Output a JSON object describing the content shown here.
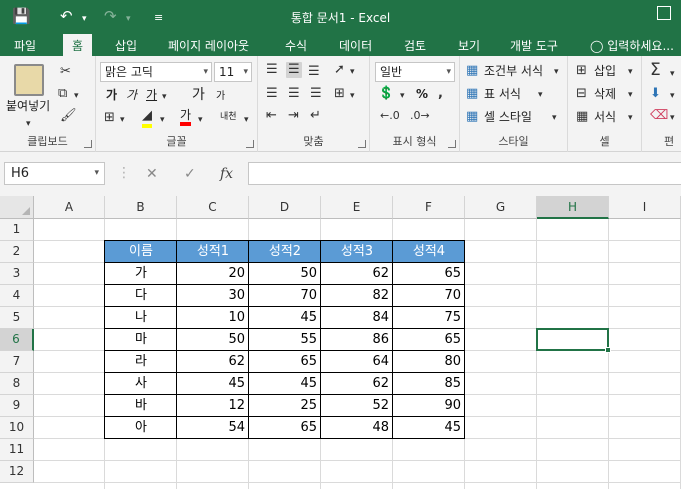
{
  "window": {
    "title": "통합 문서1 - Excel",
    "quick_access": {
      "save_icon": "save-icon",
      "undo_icon": "undo-icon",
      "redo_icon": "redo-icon",
      "customize_icon": "customize-qat-icon"
    }
  },
  "tabs": [
    "파일",
    "홈",
    "삽입",
    "페이지 레이아웃",
    "수식",
    "데이터",
    "검토",
    "보기",
    "개발 도구"
  ],
  "active_tab": "홈",
  "tell_me": "입력하세요...",
  "ribbon": {
    "clipboard": {
      "label": "클립보드",
      "paste": "붙여넣기"
    },
    "font": {
      "label": "글꼴",
      "font_name": "맑은 고딕",
      "font_size": "11",
      "bold": "가",
      "italic": "가",
      "underline": "가",
      "grow": "가",
      "shrink": "가",
      "font_color": "가",
      "phonetic": "내천"
    },
    "alignment": {
      "label": "맞춤"
    },
    "number": {
      "label": "표시 형식",
      "format": "일반",
      "percent": "%"
    },
    "styles": {
      "label": "스타일",
      "conditional": "조건부 서식",
      "table": "표 서식",
      "cell_styles": "셀 스타일"
    },
    "cells": {
      "label": "셀",
      "insert": "삽입",
      "delete": "삭제",
      "format": "서식"
    },
    "editing": {
      "label": "편"
    }
  },
  "formula_bar": {
    "name_box": "H6",
    "cancel": "✕",
    "enter": "✓",
    "fx": "fx",
    "value": ""
  },
  "columns": [
    "A",
    "B",
    "C",
    "D",
    "E",
    "F",
    "G",
    "H",
    "I"
  ],
  "rows": [
    "1",
    "2",
    "3",
    "4",
    "5",
    "6",
    "7",
    "8",
    "9",
    "10",
    "11",
    "12"
  ],
  "selected": {
    "column": "H",
    "row": "6"
  },
  "table": {
    "headers": [
      "이름",
      "성적1",
      "성적2",
      "성적3",
      "성적4"
    ],
    "rows": [
      [
        "가",
        "20",
        "50",
        "62",
        "65"
      ],
      [
        "다",
        "30",
        "70",
        "82",
        "70"
      ],
      [
        "나",
        "10",
        "45",
        "84",
        "75"
      ],
      [
        "마",
        "50",
        "55",
        "86",
        "65"
      ],
      [
        "라",
        "62",
        "65",
        "64",
        "80"
      ],
      [
        "사",
        "45",
        "45",
        "62",
        "85"
      ],
      [
        "바",
        "12",
        "25",
        "52",
        "90"
      ],
      [
        "아",
        "54",
        "65",
        "48",
        "45"
      ]
    ]
  },
  "colors": {
    "accent": "#217346",
    "table_header": "#5b9bd5"
  }
}
